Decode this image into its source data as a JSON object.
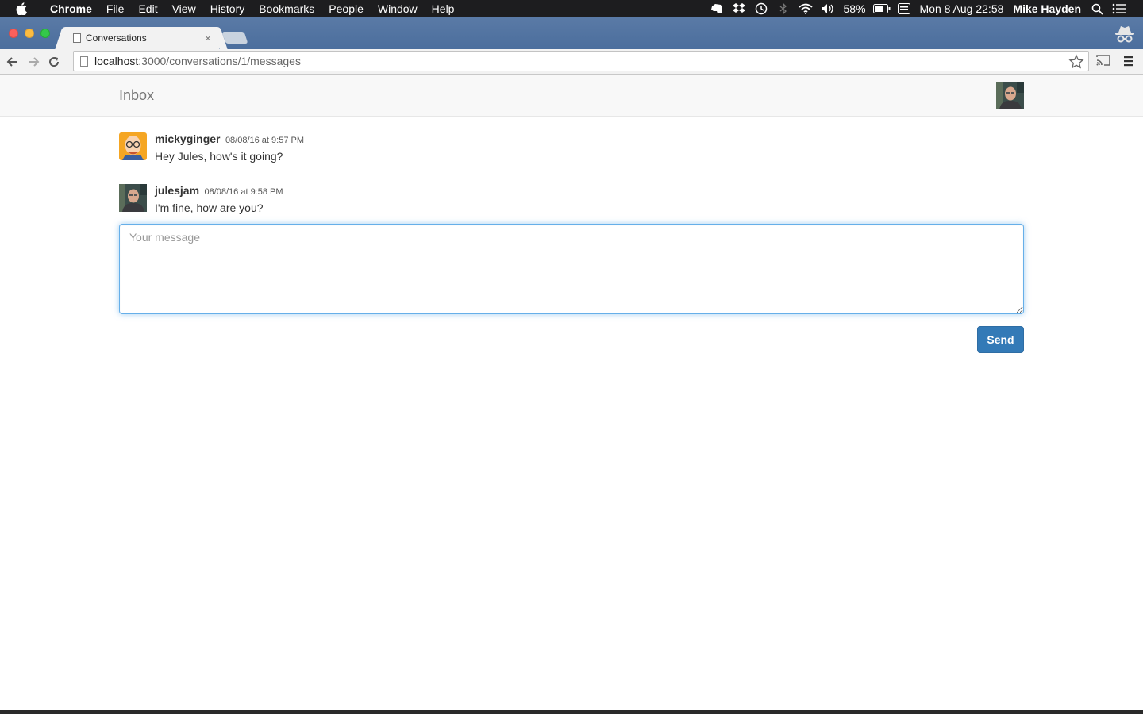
{
  "menubar": {
    "apple_icon": "apple-logo-icon",
    "app_name": "Chrome",
    "menus": [
      "File",
      "Edit",
      "View",
      "History",
      "Bookmarks",
      "People",
      "Window",
      "Help"
    ],
    "battery_percent": "58%",
    "datetime": "Mon 8 Aug  22:58",
    "user_name": "Mike Hayden",
    "status_icons": [
      "evernote-icon",
      "dropbox-icon",
      "time-machine-icon",
      "bluetooth-icon",
      "wifi-icon",
      "volume-icon",
      "battery-icon",
      "keyboard-icon",
      "spotlight-icon",
      "notification-center-icon"
    ]
  },
  "browser": {
    "tab_title": "Conversations",
    "url_host": "localhost",
    "url_path": ":3000/conversations/1/messages"
  },
  "navbar": {
    "brand": "Inbox"
  },
  "messages": [
    {
      "user": "mickyginger",
      "timestamp": "08/08/16 at 9:57 PM",
      "body": "Hey Jules, how's it going?"
    },
    {
      "user": "julesjam",
      "timestamp": "08/08/16 at 9:58 PM",
      "body": "I'm fine, how are you?"
    }
  ],
  "form": {
    "placeholder": "Your message",
    "value": "",
    "send_label": "Send"
  },
  "colors": {
    "primary": "#337ab7",
    "focus_border": "#66afe9",
    "navbar_bg": "#f8f8f8",
    "menubar_bg": "#1d1d1f",
    "tabstrip_bg": "#5a7aa6"
  }
}
